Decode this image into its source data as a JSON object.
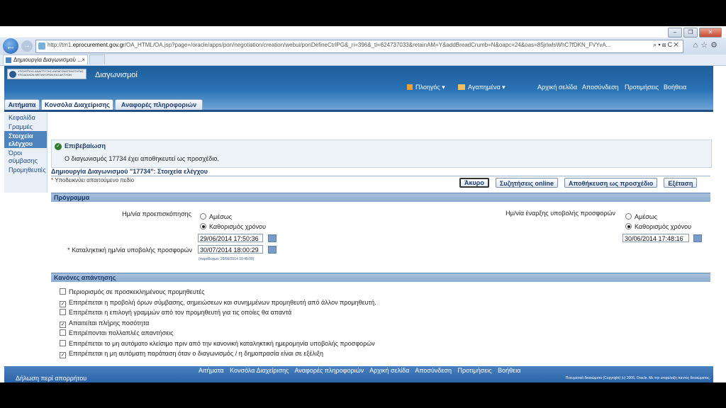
{
  "browser": {
    "url_prefix": "http://tm1.",
    "url_domain": "eprocurement.gov.gr",
    "url_rest": "/OA_HTML/OA.jsp?page=/oracle/apps/pon/negotiation/creation/webui/ponDefineCtrlPG&_ri=396&_ti=624737033&retainAM=Y&addBreadCrumb=N&oapc=24&oas=85jrlwlsWhC7fDKN_FVYvA...",
    "tab_title": "Δημιουργία Διαγωνισμού ..."
  },
  "header": {
    "app_title": "Διαγωνισμοί",
    "logo_text": "ΥΠΟΥΡΓΕΙΟ ΑΝΑΠΤΥΞΗΣ ΑΝΤΑΓΩΝΙΣΤΙΚΟΤΗΤΑΣ ΥΠΟΔΟΜΩΝ ΜΕΤΑΦΟΡΩΝ ΚΑΙ ΔΙΚΤΥΩΝ",
    "nav_menu": "Πλοηγός",
    "favorites_menu": "Αγαπημένα",
    "global_links": [
      "Αρχική σελίδα",
      "Αποσύνδεση",
      "Προτιμήσεις",
      "Βοήθεια"
    ]
  },
  "tabs": [
    {
      "label": "Αιτήματα"
    },
    {
      "label": "Κονσόλα Διαχείρισης"
    },
    {
      "label": "Αναφορές πληροφοριών"
    }
  ],
  "sidebar": {
    "items": [
      {
        "label": "Κεφαλίδα"
      },
      {
        "label": "Γραμμές"
      },
      {
        "label": "Στοιχεία ελέγχου"
      },
      {
        "label": "Όροι σύμβασης"
      },
      {
        "label": "Προμηθευτές"
      }
    ]
  },
  "confirmation": {
    "title": "Επιβεβαίωση",
    "message": "Ο διαγωνισμός 17734 έχει αποθηκευτεί ως προσχέδιο."
  },
  "page": {
    "title": "Δημιουργία Διαγωνισμού \"17734\": Στοιχεία ελέγχου",
    "required_note": "* Υποδεικνύει απαιτούμενο πεδίο"
  },
  "buttons": {
    "cancel": "Άκυρο",
    "online_discussions": "Συζητήσεις online",
    "save_draft": "Αποθήκευση ως προσχέδιο",
    "check": "Εξέταση"
  },
  "schedule": {
    "heading": "Πρόγραμμα",
    "preview_label": "Ημ/νία προεπισκόπησης",
    "immediately": "Αμέσως",
    "set_time": "Καθορισμός χρόνου",
    "preview_value": "29/06/2014 17:50:36",
    "close_label": "* Καταληκτική ημ/νία υποβολής προσφορών",
    "close_value": "30/07/2014 18:00:29",
    "close_example": "(παράδειγμα: 29/06/2014 19:45:00)",
    "open_label": "Ημ/νία έναρξης υποβολής προσφορών",
    "open_value": "30/06/2014 17:48:16"
  },
  "rules": {
    "heading": "Κανόνες απάντησης",
    "items": [
      {
        "label": "Περιορισμός σε προσκεκλημένους προμηθευτές",
        "checked": false
      },
      {
        "label": "Επιτρέπεται η προβολή όρων σύμβασης, σημειώσεων και συνημμένων προμηθευτή από άλλον προμηθευτή.",
        "checked": true
      },
      {
        "label": "Επιτρέπεται η επιλογή γραμμών από τον προμηθευτή για τις οποίες θα απαντά",
        "checked": false
      },
      {
        "label": "Απαιτείται πλήρης ποσότητα",
        "checked": true
      },
      {
        "label": "Επιτρέπονται πολλαπλές απαντήσεις",
        "checked": false
      },
      {
        "label": "Επιτρέπεται το μη αυτόματο κλείσιμο πριν από την κανονική καταληκτική ημερομηνία υποβολής προσφορών",
        "checked": false
      },
      {
        "label": "Επιτρέπεται η μη αυτόματη παράταση όταν ο διαγωνισμός / η δημοπρασία είναι σε εξέλιξη",
        "checked": true
      }
    ]
  },
  "footer": {
    "links": [
      "Αιτήματα",
      "Κονσόλα Διαχείρισης",
      "Αναφορές πληροφοριών",
      "Αρχική σελίδα",
      "Αποσύνδεση",
      "Προτιμήσεις",
      "Βοήθεια"
    ],
    "privacy": "Δήλωση περί απορρήτου",
    "copyright": "Πνευματικά δικαιώματα (Copyright) (c) 2006, Oracle. Με την επιφύλαξη παντός δικαιώματος."
  }
}
